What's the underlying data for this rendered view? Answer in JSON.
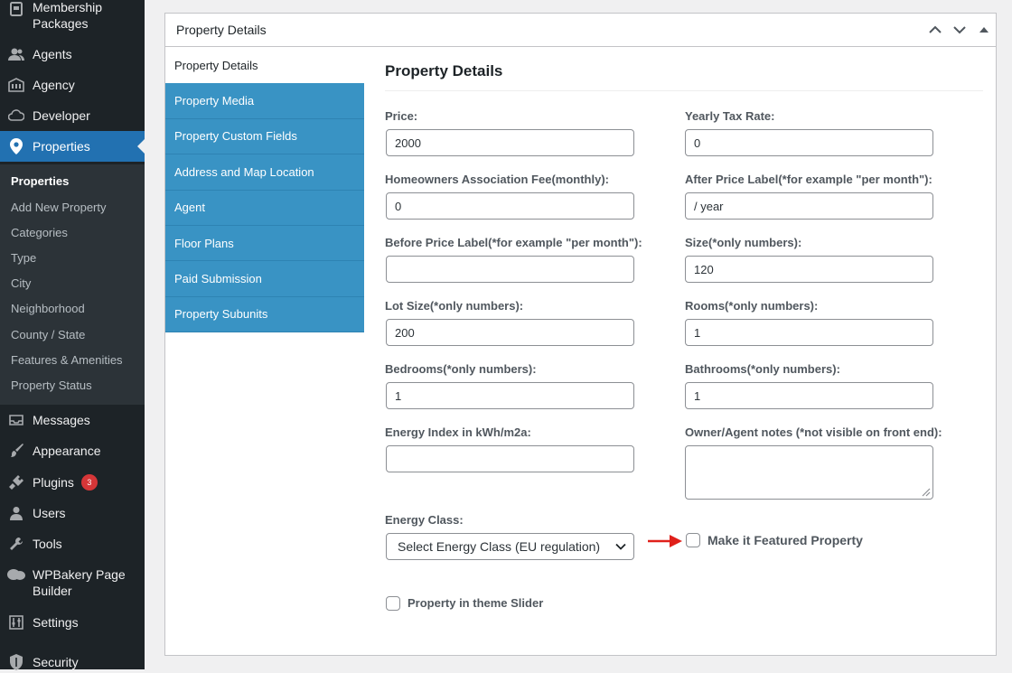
{
  "sidebar": {
    "items": [
      {
        "label": "Membership\nPackages",
        "icon": "page-icon"
      },
      {
        "label": "Agents",
        "icon": "users-icon"
      },
      {
        "label": "Agency",
        "icon": "building-icon"
      },
      {
        "label": "Developer",
        "icon": "cloud-icon"
      },
      {
        "label": "Properties",
        "icon": "location-pin-icon"
      },
      {
        "label": "Messages",
        "icon": "inbox-icon"
      },
      {
        "label": "Appearance",
        "icon": "paintbrush-icon"
      },
      {
        "label": "Plugins",
        "icon": "plugin-icon",
        "badge": "3"
      },
      {
        "label": "Users",
        "icon": "user-icon"
      },
      {
        "label": "Tools",
        "icon": "wrench-icon"
      },
      {
        "label": "WPBakery Page\nBuilder",
        "icon": "wpbakery-icon"
      },
      {
        "label": "Settings",
        "icon": "sliders-icon"
      },
      {
        "label": "Security",
        "icon": "shield-icon"
      }
    ],
    "submenu": [
      "Properties",
      "Add New Property",
      "Categories",
      "Type",
      "City",
      "Neighborhood",
      "County / State",
      "Features & Amenities",
      "Property Status"
    ]
  },
  "postbox": {
    "title": "Property Details",
    "tabs": [
      "Property Details",
      "Property Media",
      "Property Custom Fields",
      "Address and Map Location",
      "Agent",
      "Floor Plans",
      "Paid Submission",
      "Property Subunits"
    ],
    "form_title": "Property Details",
    "fields": {
      "price": {
        "label": "Price:",
        "value": "2000"
      },
      "yearly_tax": {
        "label": "Yearly Tax Rate:",
        "value": "0"
      },
      "hoa_fee": {
        "label": "Homeowners Association Fee(monthly):",
        "value": "0"
      },
      "after_price": {
        "label": "After Price Label(*for example \"per month\"):",
        "value": "/ year"
      },
      "before_price": {
        "label": "Before Price Label(*for example \"per month\"):",
        "value": ""
      },
      "size": {
        "label": "Size(*only numbers):",
        "value": "120"
      },
      "lot_size": {
        "label": "Lot Size(*only numbers):",
        "value": "200"
      },
      "rooms": {
        "label": "Rooms(*only numbers):",
        "value": "1"
      },
      "bedrooms": {
        "label": "Bedrooms(*only numbers):",
        "value": "1"
      },
      "bathrooms": {
        "label": "Bathrooms(*only numbers):",
        "value": "1"
      },
      "energy_index": {
        "label": "Energy Index in kWh/m2a:",
        "value": ""
      },
      "owner_notes": {
        "label": "Owner/Agent notes (*not visible on front end):",
        "value": ""
      },
      "energy_class": {
        "label": "Energy Class:",
        "selected": "Select Energy Class (EU regulation)"
      }
    },
    "checkboxes": {
      "featured": {
        "label": "Make it Featured Property",
        "checked": false
      },
      "slider": {
        "label": "Property in theme Slider",
        "checked": false
      }
    }
  },
  "colors": {
    "sidebar_bg": "#1d2327",
    "submenu_bg": "#2c3338",
    "active_blue": "#2271b1",
    "tab_blue": "#3993c4",
    "annotation_arrow": "#e0201a",
    "badge_red": "#d63638"
  }
}
